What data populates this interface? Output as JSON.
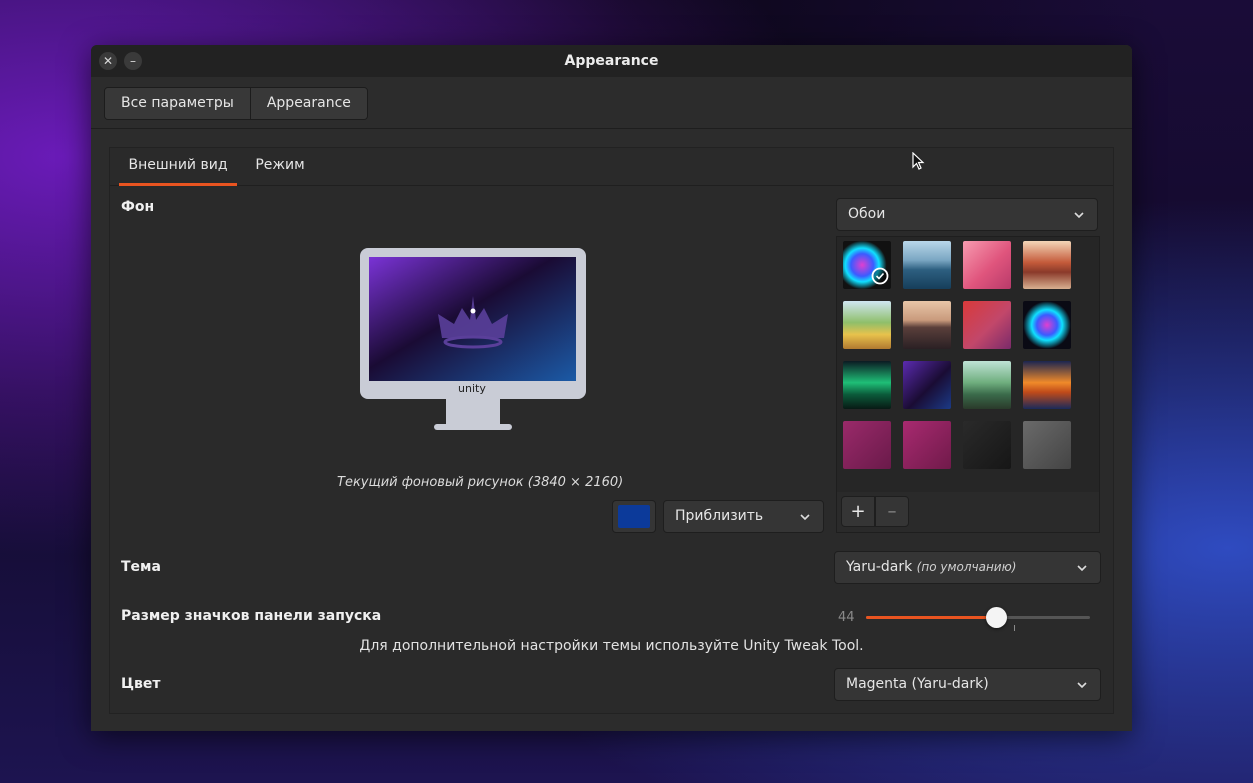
{
  "window": {
    "title": "Appearance",
    "close_glyph": "✕",
    "minimize_glyph": "–"
  },
  "breadcrumb": [
    "Все параметры",
    "Appearance"
  ],
  "tabs": [
    {
      "label": "Внешний вид",
      "active": true
    },
    {
      "label": "Режим",
      "active": false
    }
  ],
  "background": {
    "label": "Фон",
    "source_combo": "Обои",
    "monitor_label": "unity",
    "caption": "Текущий фоновый рисунок  (3840 × 2160)",
    "color_swatch": "#0c3a9a",
    "fit_combo": "Приблизить",
    "add_glyph": "+",
    "remove_glyph": "–",
    "wallpapers": [
      {
        "name": "wallpaper-neon-feathers",
        "selected": true
      },
      {
        "name": "wallpaper-sea-rocks"
      },
      {
        "name": "wallpaper-pink-sky"
      },
      {
        "name": "wallpaper-desert-canyon"
      },
      {
        "name": "wallpaper-summer-field"
      },
      {
        "name": "wallpaper-mountain-lake"
      },
      {
        "name": "wallpaper-red-creature"
      },
      {
        "name": "wallpaper-neon-feathers-dark"
      },
      {
        "name": "wallpaper-aurora"
      },
      {
        "name": "wallpaper-unity-crown"
      },
      {
        "name": "wallpaper-forest-figure"
      },
      {
        "name": "wallpaper-orange-creature"
      },
      {
        "name": "wallpaper-pink-crown"
      },
      {
        "name": "wallpaper-pink-crown-2"
      },
      {
        "name": "wallpaper-dark-crown"
      },
      {
        "name": "wallpaper-grey-crown"
      }
    ]
  },
  "theme": {
    "label": "Тема",
    "value": "Yaru-dark",
    "note": "(по  умолчанию)"
  },
  "launcher": {
    "label": "Размер значков панели запуска",
    "value": 44,
    "level": 0.58
  },
  "hint": "Для дополнительной настройки темы используйте Unity Tweak Tool.",
  "color": {
    "label": "Цвет",
    "value": "Magenta (Yaru-dark)"
  },
  "accent": "#e95420"
}
